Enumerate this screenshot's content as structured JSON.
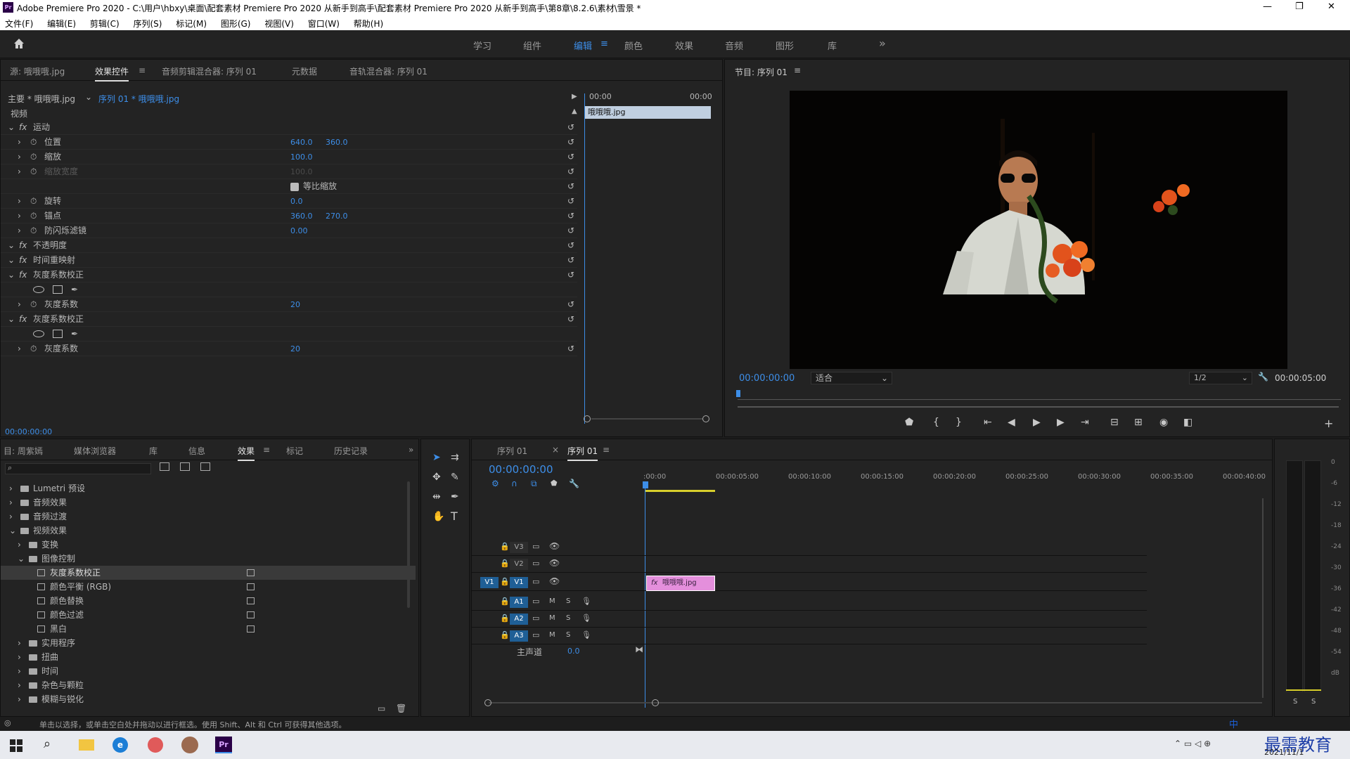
{
  "window": {
    "title": "Adobe Premiere Pro 2020 - C:\\用户\\hbxy\\桌面\\配套素材 Premiere Pro 2020 从新手到高手\\配套素材 Premiere Pro 2020 从新手到高手\\第8章\\8.2.6\\素材\\雪景 *",
    "min": "—",
    "max": "❐",
    "close": "✕"
  },
  "menu": [
    "文件(F)",
    "编辑(E)",
    "剪辑(C)",
    "序列(S)",
    "标记(M)",
    "图形(G)",
    "视图(V)",
    "窗口(W)",
    "帮助(H)"
  ],
  "workspaces": [
    "学习",
    "组件",
    "编辑",
    "颜色",
    "效果",
    "音频",
    "图形",
    "库"
  ],
  "ws_more": "»",
  "ec": {
    "tabs": [
      "源: 哦哦哦.jpg",
      "效果控件",
      "音频剪辑混合器: 序列 01",
      "元数据",
      "音轨混合器: 序列 01"
    ],
    "master": "主要 * 哦哦哦.jpg",
    "seq": "序列 01 * 哦哦哦.jpg",
    "time_start": "00:00",
    "time_end": "00:00",
    "clip": "哦哦哦.jpg",
    "video": "视频",
    "rows": [
      {
        "name": "运动",
        "fx": true,
        "v1": "",
        "v2": ""
      },
      {
        "name": "位置",
        "v1": "640.0",
        "v2": "360.0"
      },
      {
        "name": "缩放",
        "v1": "100.0",
        "v2": ""
      },
      {
        "name": "缩放宽度",
        "v1": "100.0",
        "v2": "",
        "dim": true
      },
      {
        "name": "",
        "v1": "等比缩放",
        "v2": ""
      },
      {
        "name": "旋转",
        "v1": "0.0",
        "v2": ""
      },
      {
        "name": "锚点",
        "v1": "360.0",
        "v2": "270.0"
      },
      {
        "name": "防闪烁滤镜",
        "v1": "0.00",
        "v2": ""
      },
      {
        "name": "不透明度",
        "fx": true,
        "v1": "",
        "v2": ""
      },
      {
        "name": "时间重映射",
        "fx": true,
        "v1": "",
        "v2": ""
      },
      {
        "name": "灰度系数校正",
        "fx": true,
        "v1": "",
        "v2": ""
      },
      {
        "name": "",
        "v1": "",
        "v2": "",
        "masks": true
      },
      {
        "name": "灰度系数",
        "v1": "20",
        "v2": ""
      },
      {
        "name": "灰度系数校正",
        "fx": true,
        "v1": "",
        "v2": ""
      },
      {
        "name": "",
        "v1": "",
        "v2": "",
        "masks": true
      },
      {
        "name": "灰度系数",
        "v1": "20",
        "v2": ""
      }
    ],
    "timecode": "00:00:00:00"
  },
  "program": {
    "title": "节目: 序列 01",
    "timecode": "00:00:00:00",
    "fit": "适合",
    "res": "1/2",
    "duration": "00:00:05:00"
  },
  "effects": {
    "tabs": [
      "目: 周紫嫣",
      "媒体浏览器",
      "库",
      "信息",
      "效果",
      "标记",
      "历史记录"
    ],
    "tree": [
      {
        "label": "Lumetri 预设",
        "lvl": 0
      },
      {
        "label": "音频效果",
        "lvl": 0
      },
      {
        "label": "音频过渡",
        "lvl": 0
      },
      {
        "label": "视频效果",
        "lvl": 0,
        "open": true
      },
      {
        "label": "变换",
        "lvl": 1
      },
      {
        "label": "图像控制",
        "lvl": 1,
        "open": true
      },
      {
        "label": "灰度系数校正",
        "lvl": 2,
        "sel": true
      },
      {
        "label": "颜色平衡 (RGB)",
        "lvl": 2
      },
      {
        "label": "颜色替换",
        "lvl": 2
      },
      {
        "label": "颜色过滤",
        "lvl": 2
      },
      {
        "label": "黑白",
        "lvl": 2
      },
      {
        "label": "实用程序",
        "lvl": 1
      },
      {
        "label": "扭曲",
        "lvl": 1
      },
      {
        "label": "时间",
        "lvl": 1
      },
      {
        "label": "杂色与颗粒",
        "lvl": 1
      },
      {
        "label": "模糊与锐化",
        "lvl": 1
      }
    ]
  },
  "timeline": {
    "tabs": [
      "序列 01",
      "序列 01"
    ],
    "timecode": "00:00:00:00",
    "ruler": [
      ":00:00",
      "00:00:05:00",
      "00:00:10:00",
      "00:00:15:00",
      "00:00:20:00",
      "00:00:25:00",
      "00:00:30:00",
      "00:00:35:00",
      "00:00:40:00"
    ],
    "video_tracks": [
      "V3",
      "V2",
      "V1"
    ],
    "audio_tracks": [
      "A1",
      "A2",
      "A3"
    ],
    "master": "主声道",
    "master_val": "0.0",
    "clip": "哦哦哦.jpg"
  },
  "meter": {
    "labels": [
      "0",
      "-6",
      "-12",
      "-18",
      "-24",
      "-30",
      "-36",
      "-42",
      "-48",
      "-54",
      "dB"
    ],
    "solo": [
      "S",
      "S"
    ]
  },
  "status": "单击以选择，或单击空白处并拖动以进行框选。使用 Shift、Alt 和 Ctrl 可获得其他选项。",
  "taskbar": {
    "date": "2021/11/1",
    "watermark": "最需教育",
    "ime": "中"
  },
  "colors": {
    "accent": "#3d8ee8",
    "clip": "#e48fdc",
    "panel": "#232323"
  }
}
